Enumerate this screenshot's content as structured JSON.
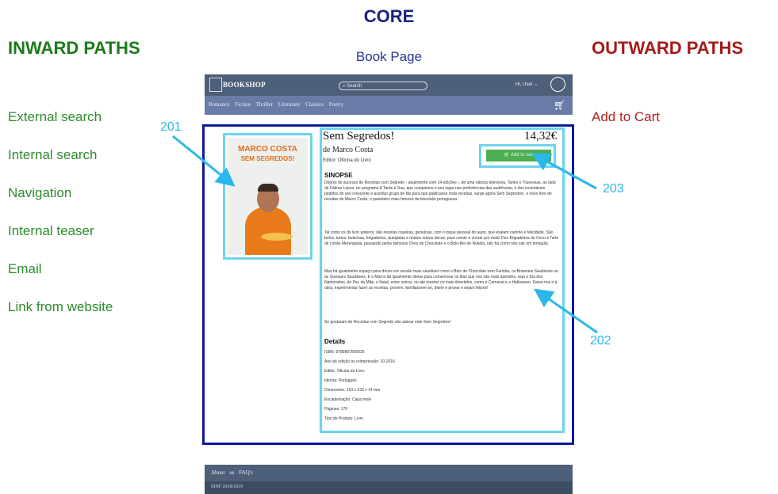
{
  "core": {
    "title": "CORE",
    "subtitle": "Book Page"
  },
  "inward": {
    "title": "INWARD PATHS",
    "items": [
      "External search",
      "Internal search",
      "Navigation",
      "Internal teaser",
      "Email",
      "Link from website"
    ]
  },
  "outward": {
    "title": "OUTWARD PATHS",
    "items": [
      "Add to Cart"
    ]
  },
  "annotations": {
    "a201": "201",
    "a202": "202",
    "a203": "203"
  },
  "mockup": {
    "logo": "BOOKSHOP",
    "search_placeholder": "Search",
    "user": "Hi, User",
    "categories": "Romance Fiction Thriller Literature Classics Poetry",
    "cover_author": "MARCO COSTA",
    "cover_title": "SEM SEGREDOS!",
    "book_title": "Sem Segredos!",
    "price": "14,32€",
    "author": "de Marco Costa",
    "publisher": "Editor: Oficina do Livro",
    "add_to_cart": "Add to cart",
    "sinopse_heading": "SINOPSE",
    "p1": "Depois do sucesso de Receitas com Segredo - atualmente com 14 edições -, de uma rubrica televisiva, Tartes e Travessas, ao lado de Fátima Lopes, no programa A Tarde é Sua, que conquistou o seu lugar nas preferências das audiências, e dos incontáveis pedidos do seu crescente e assíduo grupo de fãs para que publicasse mais receitas, surge agora Sem Segredos!, o novo livro de receitas de Marco Costa, o pasteleiro mais famoso da televisão portuguesa.",
    "p2": "Tal como os do livro anterior, são receitas caseiras, genuínas, com o toque pessoal do autor, que exalam carinho e felicidade. São bolos, tartes, bolachas, brigadeiros, queijadas e muitos outros doces, para comer e chorar por mais! Dos Brigadeiros de Coco à Tarte de Limão Merengada, passando pelos famosos Ovos de Chocolate e o Bolo-Rei de Nutella, não há como não cair em tentação.",
    "p3": "Mas há igualmente espaço para doces em versão mais saudável como o Bolo de Chocolate sem Farinha, os Brownies Saudáveis ou as Queques Saudáveis. E o Marco dá igualmente ideias para comemorar os dias que nos são mais queridos, seja o Dia dos Namorados, do Pai, da Mãe, o Natal, entre outros, ou até mesmo os mais divertidos, como o Carnaval e o Halloween. Deixe-nos ir à obra, experimentar fazer as receitas, provem, familiarizem-se, ditem e provar e sejam felizes!",
    "p4": "Se gostaram do Receitas com Segredo vão adorar este Sem Segredos!",
    "details_heading": "Details",
    "details": [
      "ISBN: 9789897800035",
      "Ano de edição ou reimpressão: 10-2016",
      "Editor: Oficina do Livro",
      "Idioma: Português",
      "Dimensões: 163 x 233 x 14 mm",
      "Encadernação: Capa mole",
      "Páginas: 176",
      "Tipo de Produto: Livro"
    ],
    "footer_links": "About us FAQ's",
    "footer_copy": "SINF 2018/2019"
  },
  "colors": {
    "core": "#1a237e",
    "inward": "#1b7a1b",
    "outward": "#a31a1a",
    "highlight": "#6dd3f0",
    "core_frame": "#0c1a9c"
  }
}
